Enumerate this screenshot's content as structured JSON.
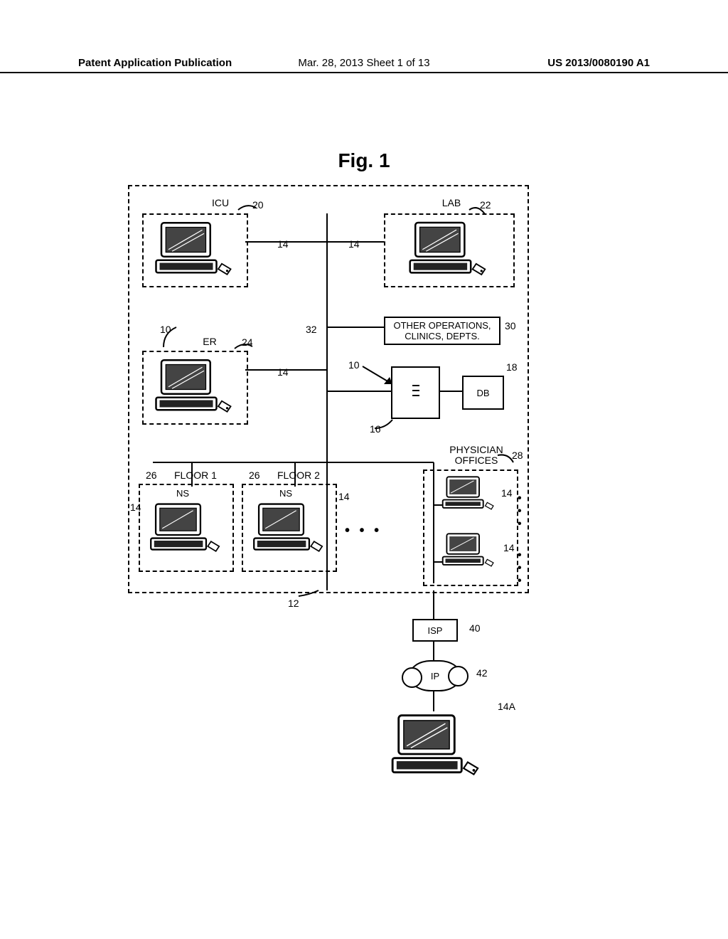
{
  "header": {
    "left": "Patent Application Publication",
    "mid": "Mar. 28, 2013  Sheet 1 of 13",
    "right": "US 2013/0080190 A1"
  },
  "figtitle": "Fig. 1",
  "labels": {
    "icu": "ICU",
    "lab": "LAB",
    "er": "ER",
    "other": "OTHER OPERATIONS,\nCLINICS, DEPTS.",
    "db": "DB",
    "floor1": "FLOOR 1",
    "floor2": "FLOOR 2",
    "ns1": "NS",
    "ns2": "NS",
    "po_title": "PHYSICIAN\nOFFICES",
    "isp": "ISP",
    "ip": "IP"
  },
  "refs": {
    "r20": "20",
    "r22": "22",
    "r24": "24",
    "r26a": "26",
    "r26b": "26",
    "r28": "28",
    "r30": "30",
    "r32": "32",
    "r10a": "10",
    "r10b": "10",
    "r12": "12",
    "r14a": "14",
    "r14b": "14",
    "r14c": "14",
    "r14d": "14",
    "r14e": "14",
    "r14f": "14",
    "r14g": "14",
    "r14A": "14A",
    "r16": "16",
    "r18": "18",
    "r40": "40",
    "r42": "42"
  },
  "dots": "• • •"
}
